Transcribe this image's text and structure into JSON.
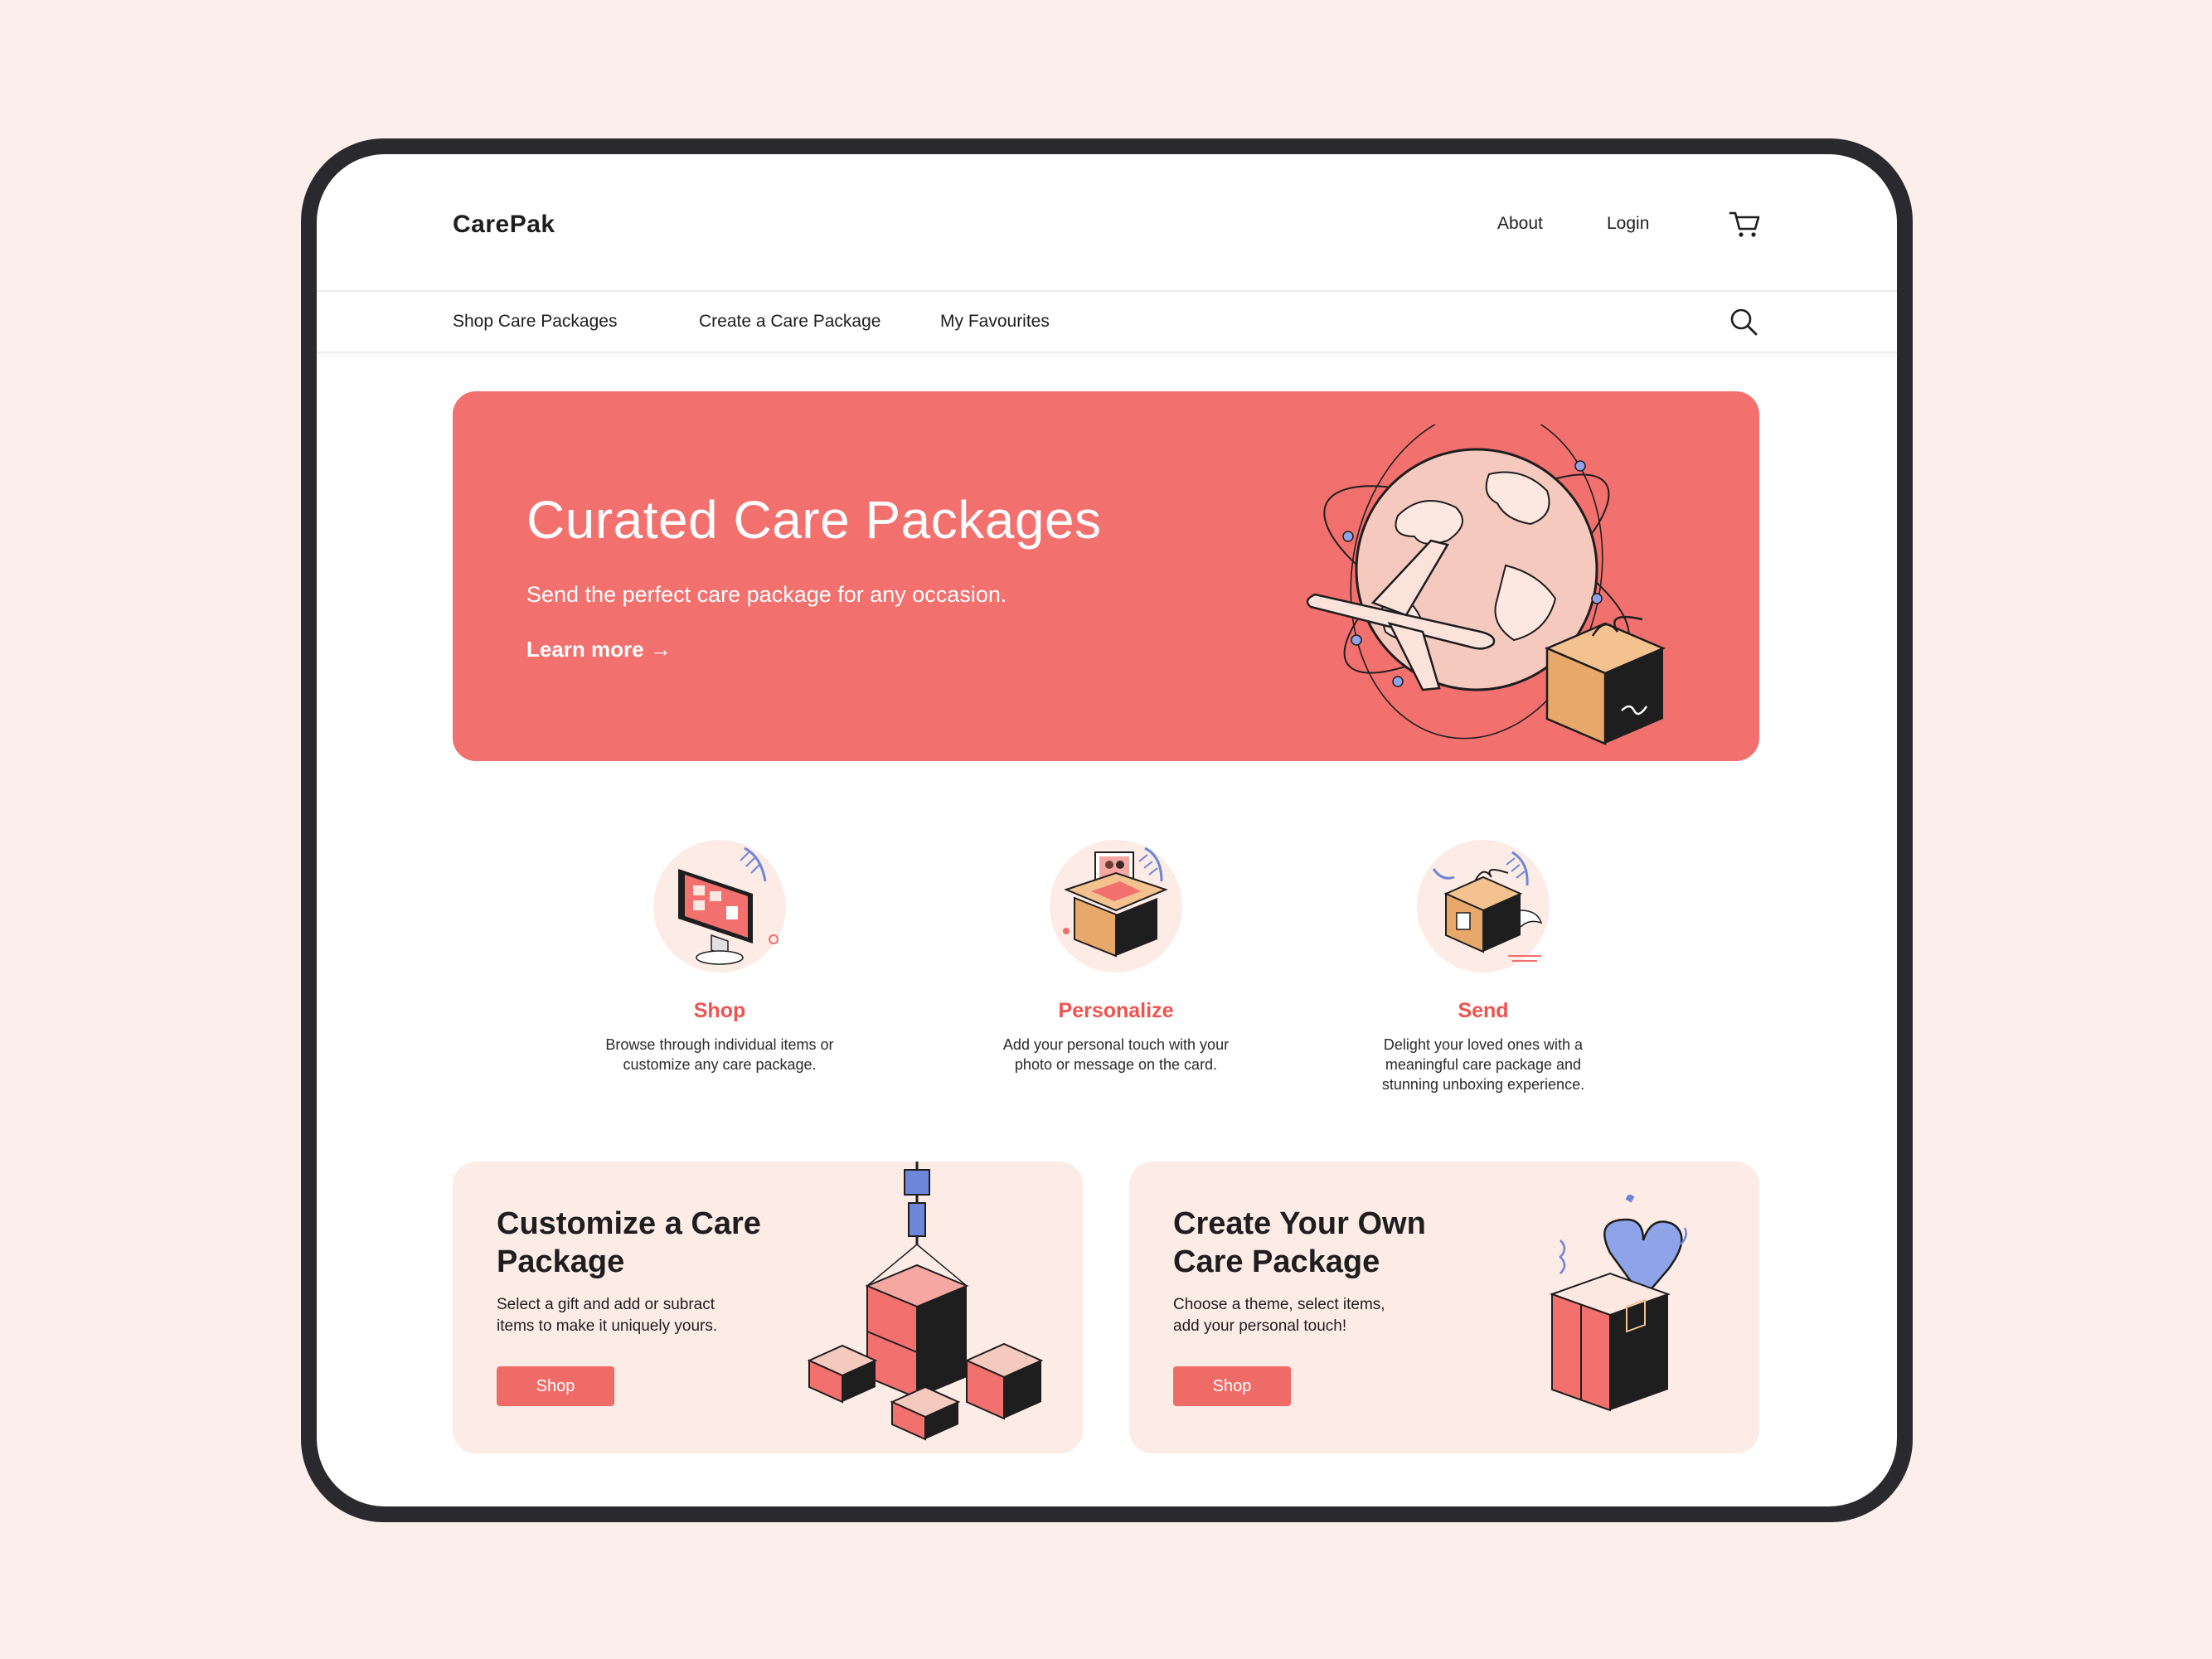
{
  "header": {
    "logo": "CarePak",
    "about": "About",
    "login": "Login"
  },
  "nav": {
    "items": [
      {
        "label": "Shop Care Packages"
      },
      {
        "label": "Create a Care Package"
      },
      {
        "label": "My Favourites"
      }
    ]
  },
  "hero": {
    "title": "Curated Care Packages",
    "subtitle": "Send the perfect care package for any occasion.",
    "link": "Learn more →"
  },
  "steps": [
    {
      "title": "Shop",
      "desc_line1": "Browse through individual items or",
      "desc_line2": "customize any care package.",
      "desc_line3": ""
    },
    {
      "title": "Personalize",
      "desc_line1": "Add your personal touch with your",
      "desc_line2": "photo or message on the card.",
      "desc_line3": ""
    },
    {
      "title": "Send",
      "desc_line1": "Delight your loved ones with a",
      "desc_line2": "meaningful care package and",
      "desc_line3": "stunning unboxing experience."
    }
  ],
  "cards": [
    {
      "title_line1": "Customize a Care",
      "title_line2": "Package",
      "desc_line1": "Select a gift and add or subract",
      "desc_line2": "items to make it uniquely yours.",
      "button": "Shop"
    },
    {
      "title_line1": "Create Your Own",
      "title_line2": "Care Package",
      "desc_line1": "Choose a theme, select items,",
      "desc_line2": "add your personal touch!",
      "button": "Shop"
    }
  ],
  "colors": {
    "background": "#fcefeb",
    "accent": "#f2706d",
    "accent_text": "#ef5350",
    "card_bg": "#fdebe6",
    "device_frame": "#2a2a2e"
  },
  "icons": [
    "cart-icon",
    "search-icon",
    "arrow-right-icon"
  ]
}
